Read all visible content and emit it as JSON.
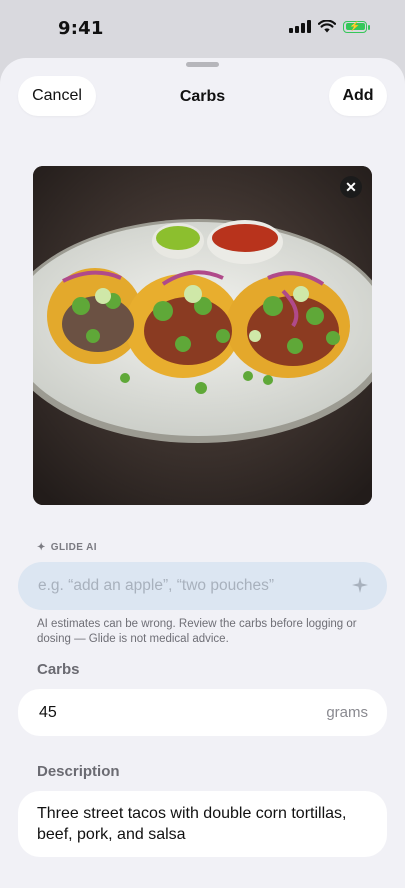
{
  "status_bar": {
    "time": "9:41"
  },
  "header": {
    "cancel_label": "Cancel",
    "title": "Carbs",
    "add_label": "Add"
  },
  "photo": {
    "description_icon": "close-icon"
  },
  "ai": {
    "section_label": "GLIDE AI",
    "placeholder": "e.g. “add an apple”, “two pouches”",
    "disclaimer": "AI estimates can be wrong. Review the carbs before logging or dosing — Glide is not medical advice."
  },
  "carbs": {
    "label": "Carbs",
    "value": "45",
    "unit": "grams"
  },
  "description": {
    "label": "Description",
    "text": "Three street tacos with double corn tortillas, beef, pork, and salsa"
  },
  "colors": {
    "accent_green": "#35c759",
    "ai_field": "#dce6f2",
    "sheet_bg": "#f1f1f6"
  }
}
